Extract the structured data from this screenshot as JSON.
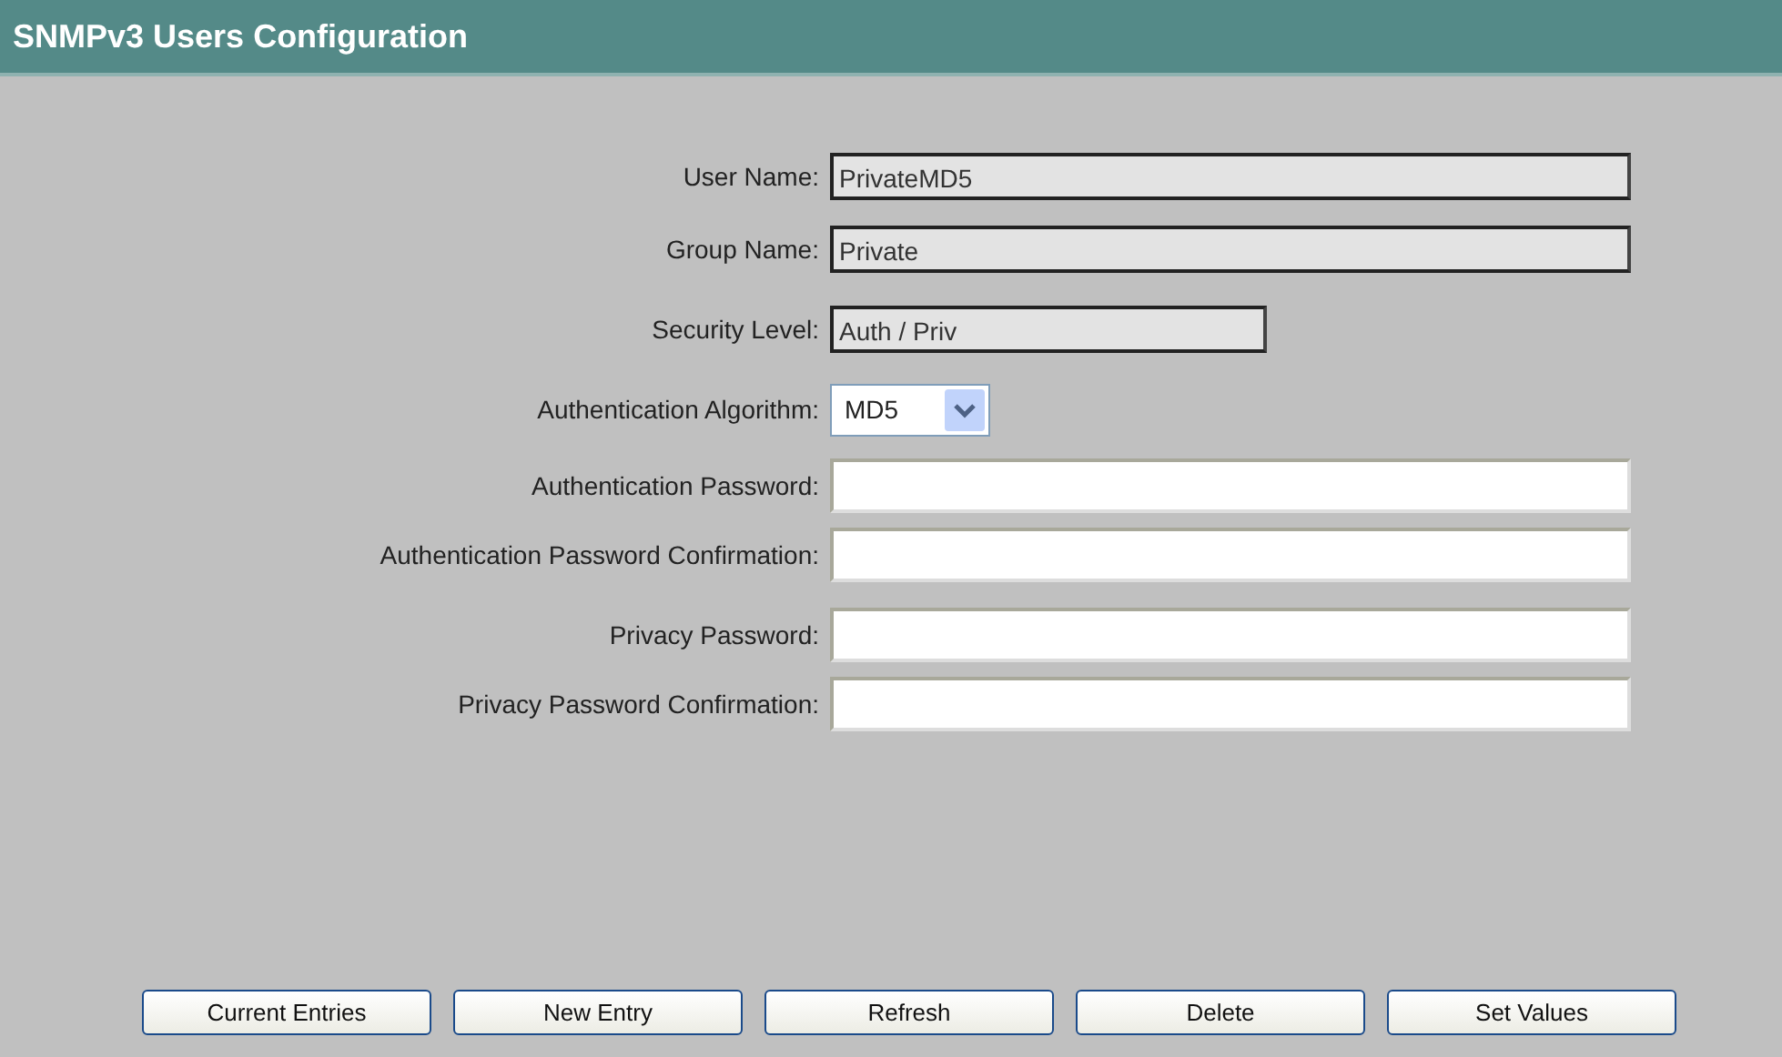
{
  "header": {
    "title": "SNMPv3 Users Configuration"
  },
  "fields": [
    {
      "label": "User Name:",
      "kind": "readonly",
      "value": "PrivateMD5"
    },
    {
      "label": "Group Name:",
      "kind": "readonly",
      "value": "Private"
    },
    {
      "label": "Security Level:",
      "kind": "compact",
      "value": "Auth / Priv"
    },
    {
      "label": "Authentication Algorithm:",
      "kind": "select",
      "value": "MD5"
    },
    {
      "label": "Authentication Password:",
      "kind": "password"
    },
    {
      "label": "Authentication Password Confirmation:",
      "kind": "password"
    },
    {
      "label": "Privacy Password:",
      "kind": "password"
    },
    {
      "label": "Privacy Password Confirmation:",
      "kind": "password"
    }
  ],
  "buttons": [
    "Current Entries",
    "New Entry",
    "Refresh",
    "Delete",
    "Set Values"
  ]
}
